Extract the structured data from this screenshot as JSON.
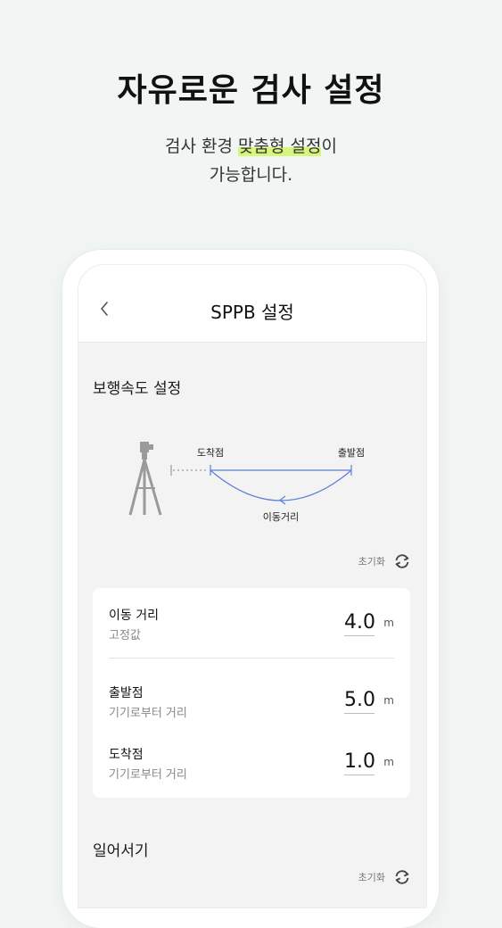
{
  "hero": {
    "title": "자유로운 검사 설정",
    "subtitle_pre": "검사 환경 ",
    "subtitle_highlight": "맞춤형 설정",
    "subtitle_post": "이",
    "subtitle_line2": "가능합니다."
  },
  "header": {
    "back_icon": "chevron-left-icon",
    "title": "SPPB 설정"
  },
  "gait_section": {
    "title": "보행속도 설정",
    "diagram": {
      "arrival_label": "도착점",
      "start_label": "출발점",
      "distance_label": "이동거리"
    },
    "reset": {
      "label": "초기화",
      "icon": "refresh-icon"
    },
    "rows": [
      {
        "label": "이동 거리",
        "desc": "고정값",
        "value": "4.0",
        "unit": "m"
      },
      {
        "label": "출발점",
        "desc": "기기로부터 거리",
        "value": "5.0",
        "unit": "m"
      },
      {
        "label": "도착점",
        "desc": "기기로부터 거리",
        "value": "1.0",
        "unit": "m"
      }
    ]
  },
  "sit_stand_section": {
    "title": "일어서기",
    "reset": {
      "label": "초기화",
      "icon": "refresh-icon"
    }
  },
  "colors": {
    "accent_line": "#5b7fd6",
    "highlight": "#d6f77a",
    "background": "#f1f5f4"
  }
}
